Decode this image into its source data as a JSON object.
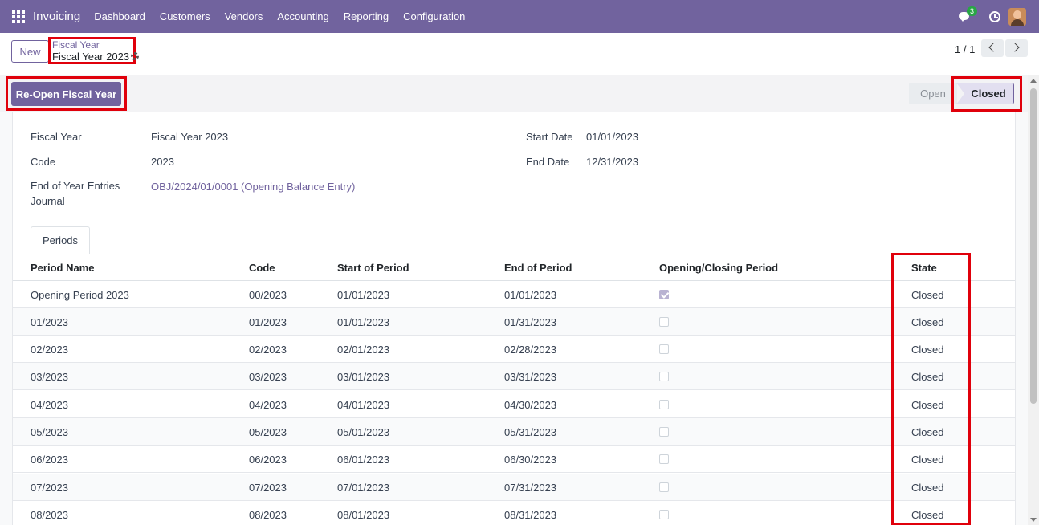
{
  "navbar": {
    "app_name": "Invoicing",
    "menu": [
      "Dashboard",
      "Customers",
      "Vendors",
      "Accounting",
      "Reporting",
      "Configuration"
    ],
    "chat_count": "3"
  },
  "control": {
    "new_label": "New",
    "breadcrumb_parent": "Fiscal Year",
    "breadcrumb_current": "Fiscal Year 2023",
    "pager": "1 / 1"
  },
  "statusbar": {
    "reopen_label": "Re-Open Fiscal Year",
    "stages": [
      "Open",
      "Closed"
    ],
    "active_stage": "Closed"
  },
  "form": {
    "fiscal_year_label": "Fiscal Year",
    "fiscal_year_value": "Fiscal Year 2023",
    "code_label": "Code",
    "code_value": "2023",
    "end_entries_label_1": "End of Year Entries",
    "end_entries_label_2": "Journal",
    "end_entries_value": "OBJ/2024/01/0001 (Opening Balance Entry)",
    "start_date_label": "Start Date",
    "start_date_value": "01/01/2023",
    "end_date_label": "End Date",
    "end_date_value": "12/31/2023"
  },
  "tabs": [
    "Periods"
  ],
  "periods": {
    "columns": [
      "Period Name",
      "Code",
      "Start of Period",
      "End of Period",
      "Opening/Closing Period",
      "State"
    ],
    "rows": [
      {
        "name": "Opening Period 2023",
        "code": "00/2023",
        "start": "01/01/2023",
        "end": "01/01/2023",
        "opening": true,
        "state": "Closed"
      },
      {
        "name": "01/2023",
        "code": "01/2023",
        "start": "01/01/2023",
        "end": "01/31/2023",
        "opening": false,
        "state": "Closed"
      },
      {
        "name": "02/2023",
        "code": "02/2023",
        "start": "02/01/2023",
        "end": "02/28/2023",
        "opening": false,
        "state": "Closed"
      },
      {
        "name": "03/2023",
        "code": "03/2023",
        "start": "03/01/2023",
        "end": "03/31/2023",
        "opening": false,
        "state": "Closed"
      },
      {
        "name": "04/2023",
        "code": "04/2023",
        "start": "04/01/2023",
        "end": "04/30/2023",
        "opening": false,
        "state": "Closed"
      },
      {
        "name": "05/2023",
        "code": "05/2023",
        "start": "05/01/2023",
        "end": "05/31/2023",
        "opening": false,
        "state": "Closed"
      },
      {
        "name": "06/2023",
        "code": "06/2023",
        "start": "06/01/2023",
        "end": "06/30/2023",
        "opening": false,
        "state": "Closed"
      },
      {
        "name": "07/2023",
        "code": "07/2023",
        "start": "07/01/2023",
        "end": "07/31/2023",
        "opening": false,
        "state": "Closed"
      },
      {
        "name": "08/2023",
        "code": "08/2023",
        "start": "08/01/2023",
        "end": "08/31/2023",
        "opening": false,
        "state": "Closed"
      }
    ]
  },
  "colors": {
    "brand": "#71639e",
    "highlight": "#e0000b"
  }
}
